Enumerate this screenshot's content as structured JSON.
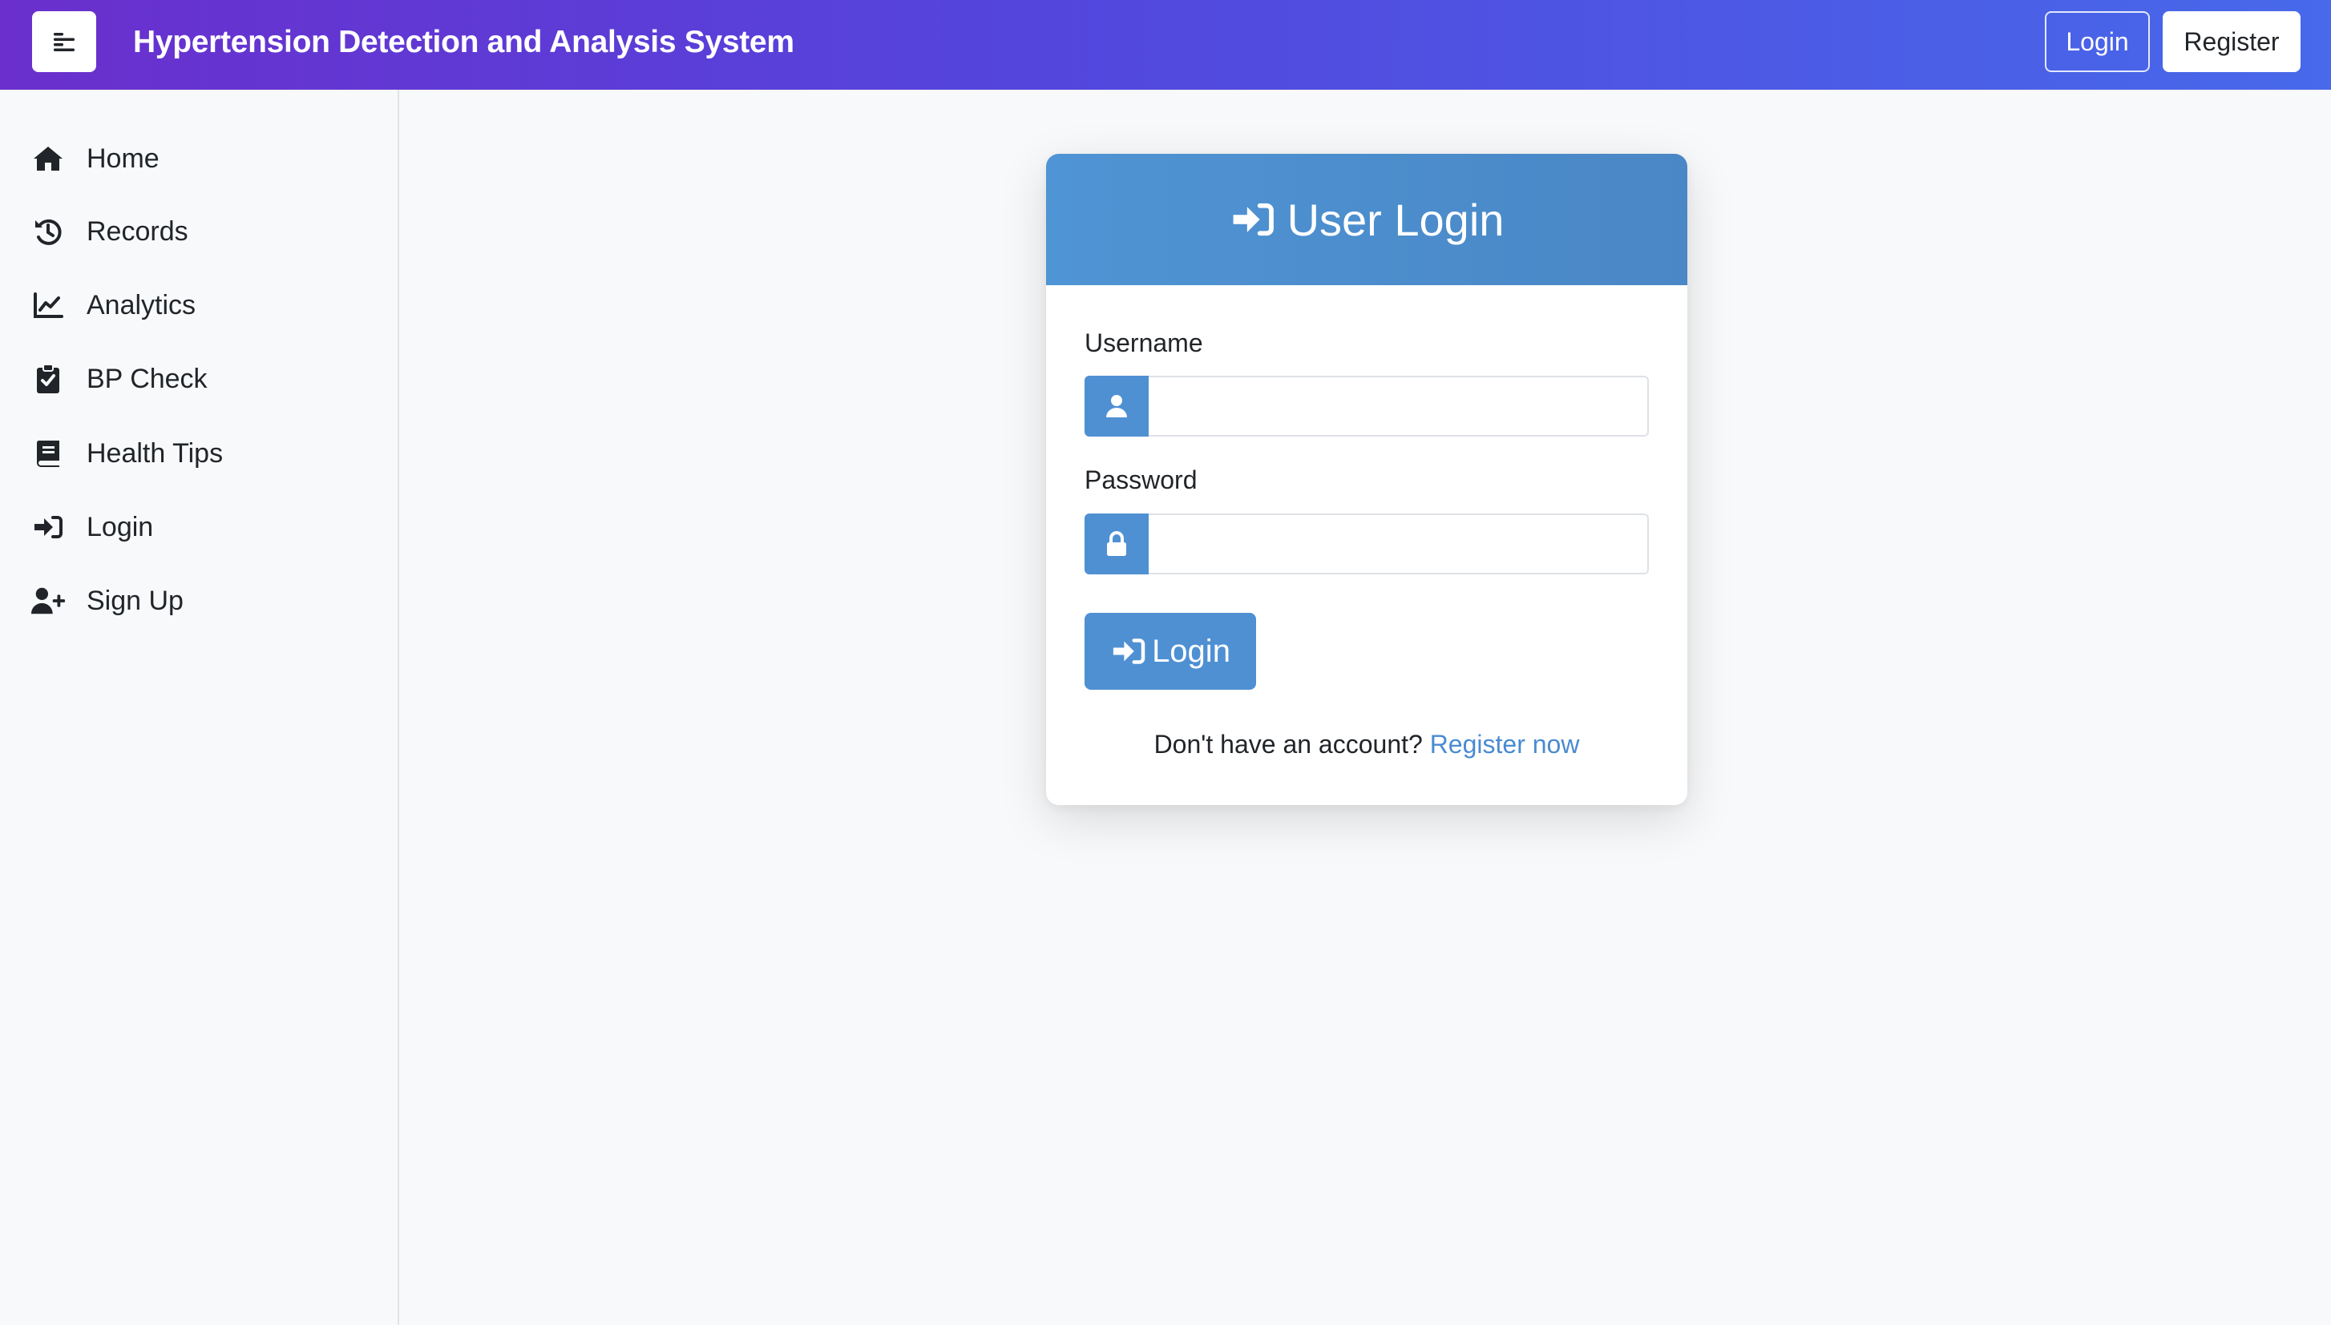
{
  "navbar": {
    "brand": "Hypertension Detection and Analysis System",
    "menu_icon": "menu-lines-icon",
    "login_label": "Login",
    "register_label": "Register",
    "gradient_start": "#6a2fcd",
    "gradient_end": "#4769ea"
  },
  "sidebar": {
    "items": [
      {
        "label": "Home",
        "icon": "home-icon"
      },
      {
        "label": "Records",
        "icon": "history-icon"
      },
      {
        "label": "Analytics",
        "icon": "chart-line-icon"
      },
      {
        "label": "BP Check",
        "icon": "clipboard-check-icon"
      },
      {
        "label": "Health Tips",
        "icon": "book-icon"
      },
      {
        "label": "Login",
        "icon": "sign-in-icon"
      },
      {
        "label": "Sign Up",
        "icon": "user-plus-icon"
      }
    ]
  },
  "login_card": {
    "title": "User Login",
    "title_icon": "sign-in-icon",
    "username_label": "Username",
    "username_value": "",
    "username_icon": "user-icon",
    "password_label": "Password",
    "password_value": "",
    "password_icon": "lock-icon",
    "submit_label": "Login",
    "submit_icon": "sign-in-icon",
    "no_account_text": "Don't have an account?",
    "register_link": "Register now",
    "accent_color": "#4f90d3"
  }
}
